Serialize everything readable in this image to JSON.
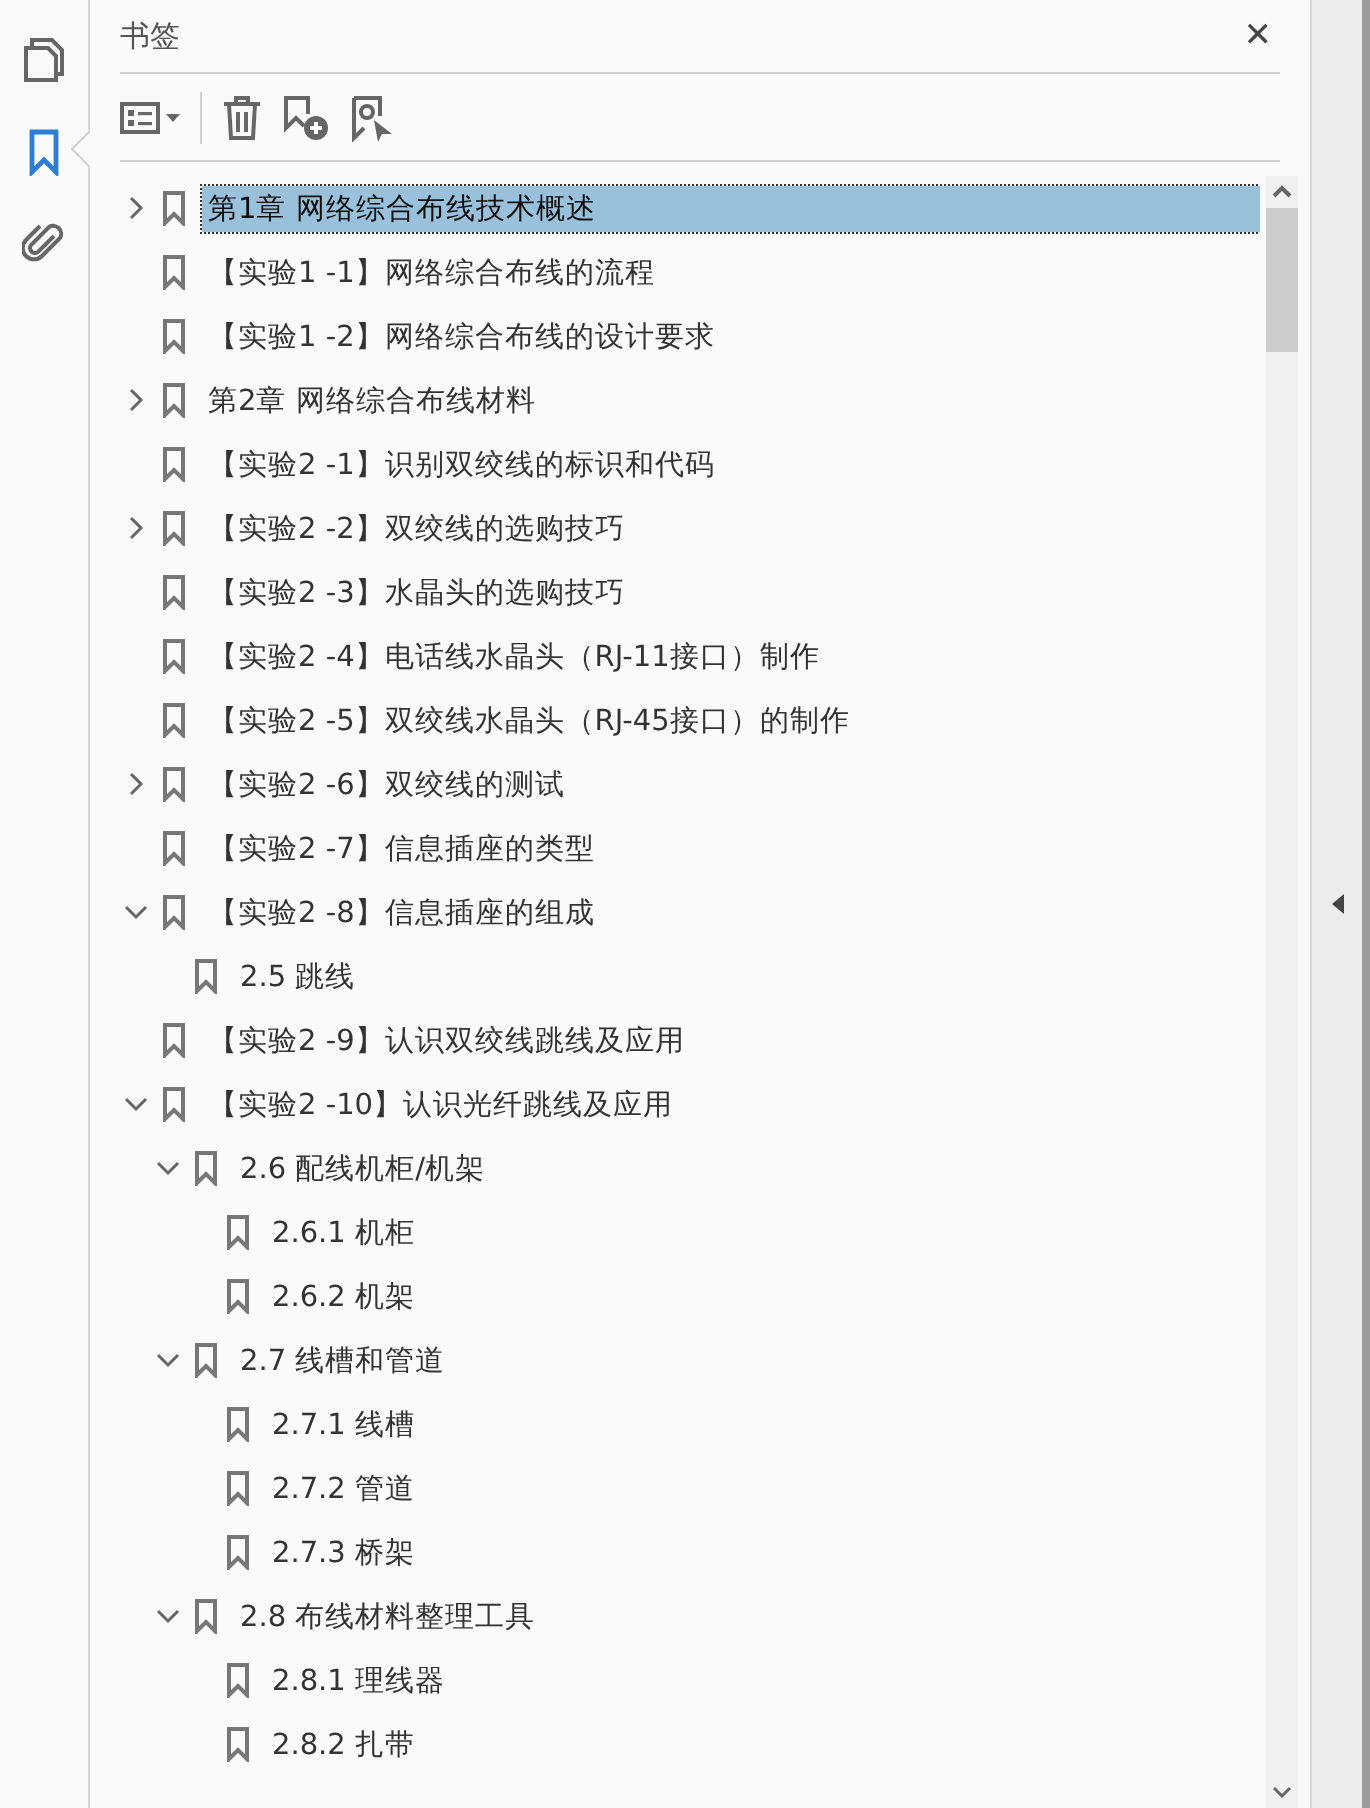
{
  "panel": {
    "title": "书签",
    "close": "✕"
  },
  "bookmarks": [
    {
      "label": "第1章 网络综合布线技术概述",
      "kind": "folder",
      "expanded": false,
      "selected": true
    },
    {
      "label": "【实验1 -1】网络综合布线的流程",
      "kind": "leaf",
      "selected": false
    },
    {
      "label": "【实验1 -2】网络综合布线的设计要求",
      "kind": "leaf",
      "selected": false
    },
    {
      "label": "第2章 网络综合布线材料",
      "kind": "folder",
      "expanded": false,
      "selected": false
    },
    {
      "label": "【实验2 -1】识别双绞线的标识和代码",
      "kind": "leaf",
      "selected": false
    },
    {
      "label": "【实验2 -2】双绞线的选购技巧",
      "kind": "folder",
      "expanded": false,
      "selected": false
    },
    {
      "label": "【实验2 -3】水晶头的选购技巧",
      "kind": "leaf",
      "selected": false
    },
    {
      "label": "【实验2 -4】电话线水晶头（RJ-11接口）制作",
      "kind": "leaf",
      "selected": false
    },
    {
      "label": "【实验2 -5】双绞线水晶头（RJ-45接口）的制作",
      "kind": "leaf",
      "selected": false
    },
    {
      "label": "【实验2 -6】双绞线的测试",
      "kind": "folder",
      "expanded": false,
      "selected": false
    },
    {
      "label": "【实验2 -7】信息插座的类型",
      "kind": "leaf",
      "selected": false
    },
    {
      "label": "【实验2 -8】信息插座的组成",
      "kind": "folder",
      "expanded": true,
      "selected": false,
      "children": [
        {
          "label": "2.5 跳线",
          "kind": "leaf",
          "selected": false
        }
      ]
    },
    {
      "label": "【实验2 -9】认识双绞线跳线及应用",
      "kind": "leaf",
      "selected": false
    },
    {
      "label": "【实验2 -10】认识光纤跳线及应用",
      "kind": "folder",
      "expanded": true,
      "selected": false,
      "children": [
        {
          "label": "2.6 配线机柜/机架",
          "kind": "folder",
          "expanded": true,
          "selected": false,
          "children": [
            {
              "label": "2.6.1 机柜",
              "kind": "leaf",
              "selected": false
            },
            {
              "label": "2.6.2 机架",
              "kind": "leaf",
              "selected": false
            }
          ]
        },
        {
          "label": "2.7 线槽和管道",
          "kind": "folder",
          "expanded": true,
          "selected": false,
          "children": [
            {
              "label": "2.7.1 线槽",
              "kind": "leaf",
              "selected": false
            },
            {
              "label": "2.7.2 管道",
              "kind": "leaf",
              "selected": false
            },
            {
              "label": "2.7.3 桥架",
              "kind": "leaf",
              "selected": false
            }
          ]
        },
        {
          "label": "2.8 布线材料整理工具",
          "kind": "folder",
          "expanded": true,
          "selected": false,
          "children": [
            {
              "label": "2.8.1 理线器",
              "kind": "leaf",
              "selected": false
            },
            {
              "label": "2.8.2 扎带",
              "kind": "leaf",
              "selected": false
            }
          ]
        }
      ]
    }
  ]
}
